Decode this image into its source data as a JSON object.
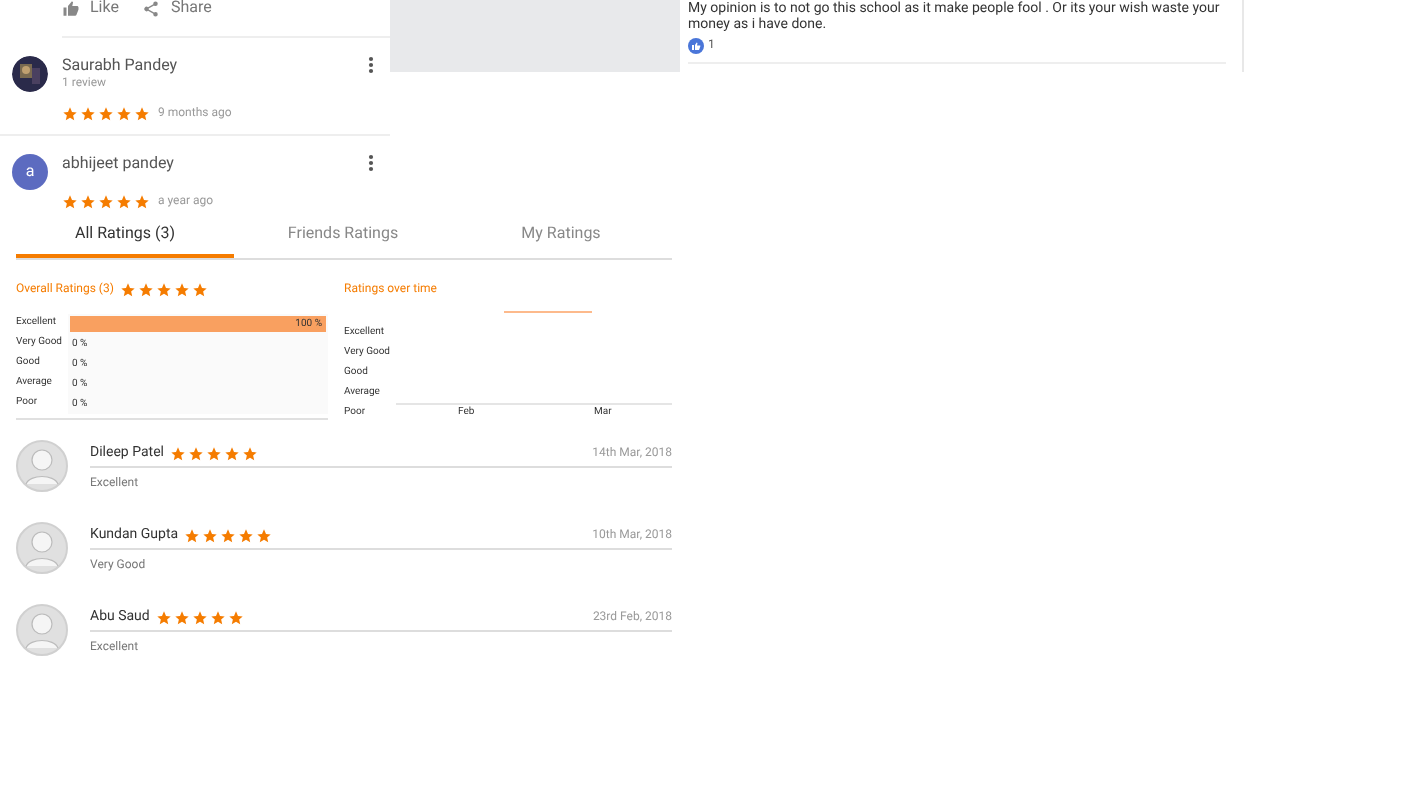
{
  "top_actions": [
    {
      "kind": "like",
      "label": "Like"
    },
    {
      "kind": "share",
      "label": "Share"
    }
  ],
  "google_reviews": [
    {
      "name": "Saurabh Pandey",
      "subtitle": "1 review",
      "stars": 5,
      "time": "9 months ago"
    },
    {
      "name": "abhijeet pandey",
      "kind": "letter",
      "initial": "a",
      "stars": 5,
      "time": "a year ago"
    }
  ],
  "comment": {
    "text": "My opinion is to not go this school as it make people fool . Or its your wish waste your money as i have done.",
    "likes": "1"
  },
  "tabs": [
    {
      "label": "All Ratings (3)",
      "selected": true
    },
    {
      "label": "Friends Ratings",
      "selected": false
    },
    {
      "label": "My Ratings",
      "selected": false
    }
  ],
  "overall": {
    "title": "Overall Ratings (3)",
    "stars": 5,
    "bars": [
      {
        "label": "Excellent",
        "level": 1,
        "reading": "100 %"
      },
      {
        "label": "Very Good",
        "reading": "0 %"
      },
      {
        "label": "Good",
        "reading": "0 %"
      },
      {
        "label": "Average",
        "reading": "0 %"
      },
      {
        "label": "Poor",
        "reading": "0 %"
      }
    ]
  },
  "ratings_over_time": {
    "title": "Ratings over time",
    "y_labels": [
      "Excellent",
      "Very Good",
      "Good",
      "Average",
      "Poor"
    ],
    "x_labels": [
      "Feb",
      "Mar"
    ]
  },
  "reviews": [
    {
      "name": "Dileep Patel",
      "stars": 5,
      "date": "14th Mar, 2018",
      "comment": "Excellent"
    },
    {
      "name": "Kundan Gupta",
      "stars": 5,
      "date": "10th Mar, 2018",
      "comment": "Very Good"
    },
    {
      "name": "Abu Saud",
      "stars": 5,
      "date": "23rd Feb, 2018",
      "comment": "Excellent"
    }
  ]
}
